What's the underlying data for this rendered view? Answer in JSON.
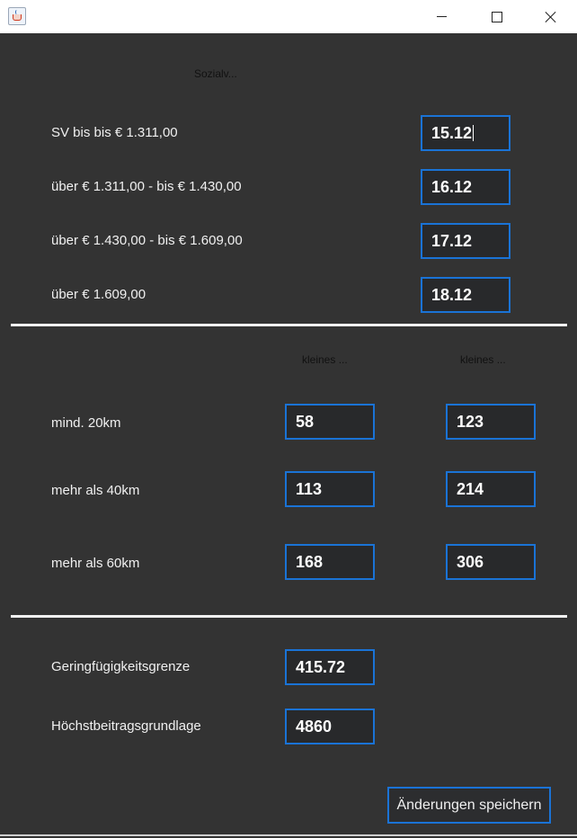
{
  "sv": {
    "header": "Sozialv...",
    "rows": [
      {
        "label": "SV bis bis € 1.311,00",
        "value": "15.12"
      },
      {
        "label": "über € 1.311,00 - bis € 1.430,00",
        "value": "16.12"
      },
      {
        "label": "über € 1.430,00 - bis € 1.609,00",
        "value": "17.12"
      },
      {
        "label": "über € 1.609,00",
        "value": "18.12"
      }
    ]
  },
  "pendler": {
    "col1_header": "kleines ...",
    "col2_header": "kleines ...",
    "rows": [
      {
        "label": "mind. 20km",
        "v1": "58",
        "v2": "123"
      },
      {
        "label": "mehr als 40km",
        "v1": "113",
        "v2": "214"
      },
      {
        "label": "mehr als 60km",
        "v1": "168",
        "v2": "306"
      }
    ]
  },
  "limits": {
    "geringfuegig_label": "Geringfügigkeitsgrenze",
    "geringfuegig_value": "415.72",
    "hoechst_label": "Höchstbeitragsgrundlage",
    "hoechst_value": "4860"
  },
  "save_label": "Änderungen speichern"
}
